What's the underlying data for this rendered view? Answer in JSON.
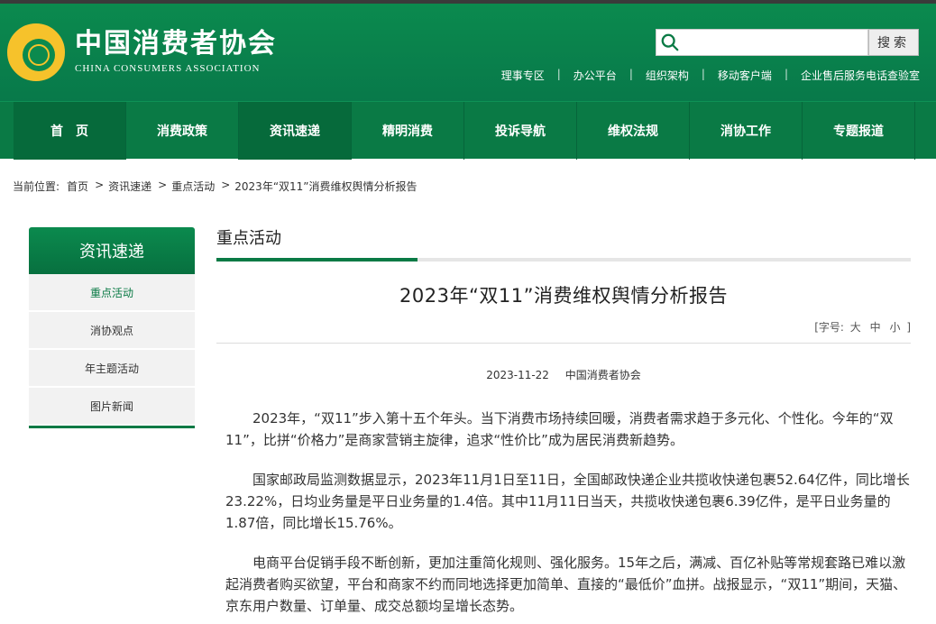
{
  "header": {
    "title_cn": "中国消费者协会",
    "title_en": "CHINA CONSUMERS ASSOCIATION",
    "search": {
      "placeholder": "",
      "button": "搜索"
    },
    "links": [
      "理事专区",
      "办公平台",
      "组织架构",
      "移动客户端",
      "企业售后服务电话查验室"
    ]
  },
  "nav": [
    "首　页",
    "消费政策",
    "资讯速递",
    "精明消费",
    "投诉导航",
    "维权法规",
    "消协工作",
    "专题报道"
  ],
  "breadcrumb": {
    "label": "当前位置:",
    "items": [
      "首页",
      "资讯速递",
      "重点活动",
      "2023年“双11”消费维权舆情分析报告"
    ]
  },
  "sidebar": {
    "title": "资讯速递",
    "items": [
      "重点活动",
      "消协观点",
      "年主题活动",
      "图片新闻"
    ]
  },
  "main": {
    "section_title": "重点活动",
    "article_title": "2023年“双11”消费维权舆情分析报告",
    "fontsize": {
      "prefix": "[字号:",
      "big": "大",
      "mid": "中",
      "small": "小",
      "suffix": "]"
    },
    "date": "2023-11-22",
    "source": "中国消费者协会",
    "paragraphs": [
      "2023年，“双11”步入第十五个年头。当下消费市场持续回暖，消费者需求趋于多元化、个性化。今年的“双11”，比拼“价格力”是商家营销主旋律，追求“性价比”成为居民消费新趋势。",
      "国家邮政局监测数据显示，2023年11月1日至11日，全国邮政快递企业共揽收快递包裹52.64亿件，同比增长23.22%，日均业务量是平日业务量的1.4倍。其中11月11日当天，共揽收快递包裹6.39亿件，是平日业务量的1.87倍，同比增长15.76%。",
      "电商平台促销手段不断创新，更加注重简化规则、强化服务。15年之后，满减、百亿补贴等常规套路已难以激起消费者购买欲望，平台和商家不约而同地选择更加简单、直接的“最低价”血拼。战报显示，“双11”期间，天猫、京东用户数量、订单量、成交总额均呈增长态势。"
    ]
  },
  "colors": {
    "brand_green": "#0a7a45",
    "logo_gold": "#f6c22b"
  }
}
